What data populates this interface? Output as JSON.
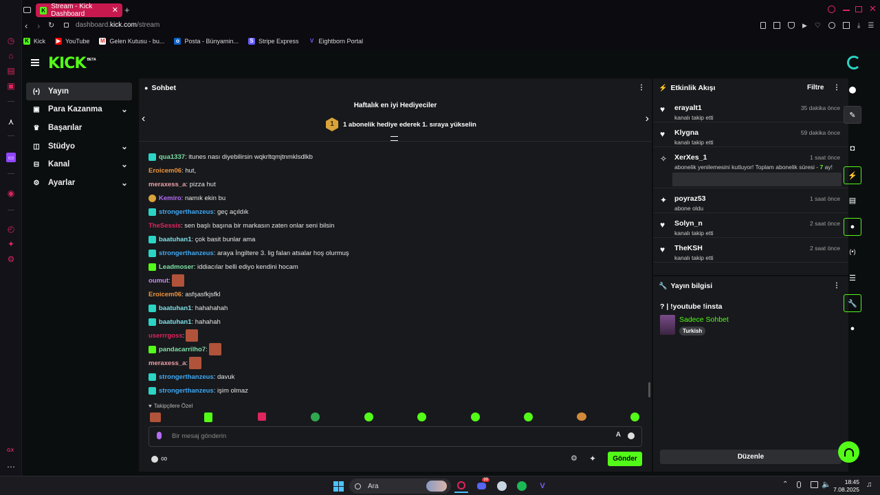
{
  "browser": {
    "tab_title": "Stream - Kick Dashboard",
    "url_prefix": "dashboard.",
    "url_domain": "kick.com",
    "url_path": "/stream",
    "bookmarks": [
      "Kick",
      "YouTube",
      "Gelen Kutusu - bu...",
      "Posta - Bünyamin...",
      "Stripe Express",
      "Eightborn Portal"
    ],
    "side_gx": "GX"
  },
  "kick": {
    "logo": "KICK",
    "logo_badge": "BETA",
    "nav": [
      {
        "label": "Yayın",
        "icon": "broadcast-icon"
      },
      {
        "label": "Para Kazanma",
        "icon": "money-icon"
      },
      {
        "label": "Başarılar",
        "icon": "trophy-icon"
      },
      {
        "label": "Stüdyo",
        "icon": "studio-icon"
      },
      {
        "label": "Kanal",
        "icon": "channel-icon"
      },
      {
        "label": "Ayarlar",
        "icon": "gear-icon"
      }
    ],
    "chat": {
      "title": "Sohbet",
      "gifters_title": "Haftalık en iyi Hediyeciler",
      "gifters_rank": "1",
      "gifters_text": "1 abonelik hediye ederek 1. sıraya yükselin",
      "messages": [
        {
          "user": "qua1337",
          "color": "#7ee0a8",
          "text": ": itunes nası diyebilirsin wqkrltqmjtnmklsdlkb",
          "badge": "sub"
        },
        {
          "user": "Eroicem06",
          "color": "#f0953d",
          "text": ": hut,",
          "badge": ""
        },
        {
          "user": "meraxess_a",
          "color": "#e8a0a8",
          "text": ": pizza hut",
          "badge": ""
        },
        {
          "user": "Kemiro",
          "color": "#b46cf5",
          "text": ": namık ekin bu",
          "badge": "gold"
        },
        {
          "user": "strongerthanzeus",
          "color": "#3fa9f5",
          "text": ": geç açıldık",
          "badge": "sub"
        },
        {
          "user": "TheSessis",
          "color": "#e0245e",
          "text": ": sen başlı başına bir markasın zaten onlar seni bilsin",
          "badge": ""
        },
        {
          "user": "baatuhan1",
          "color": "#7ee0e8",
          "text": ": çok basit bunlar ama",
          "badge": "sub"
        },
        {
          "user": "strongerthanzeus",
          "color": "#3fa9f5",
          "text": ": araya İngiltere 3. lig falan atsalar hoş olurmuş",
          "badge": "sub"
        },
        {
          "user": "Leadmoser",
          "color": "#7ee0a8",
          "text": ": iddiacılar belli ediyo kendini hocam",
          "badge": "green"
        },
        {
          "user": "oumut",
          "color": "#c58cf5",
          "text": ":",
          "badge": "",
          "emote": true
        },
        {
          "user": "Eroicem06",
          "color": "#f0953d",
          "text": ": asfşasfkjsfkl",
          "badge": ""
        },
        {
          "user": "baatuhan1",
          "color": "#7ee0e8",
          "text": ": hahahahah",
          "badge": "sub"
        },
        {
          "user": "baatuhan1",
          "color": "#7ee0e8",
          "text": ": hahahah",
          "badge": "sub"
        },
        {
          "user": "userrrgoss",
          "color": "#e0245e",
          "text": ":",
          "badge": "",
          "emote": true
        },
        {
          "user": "pandacarrilho7",
          "color": "#7ee0a8",
          "text": ":",
          "badge": "green",
          "emote": true
        },
        {
          "user": "meraxess_a",
          "color": "#e8a0a8",
          "text": ":",
          "badge": "",
          "emote": true
        },
        {
          "user": "strongerthanzeus",
          "color": "#3fa9f5",
          "text": ": davuk",
          "badge": "sub"
        },
        {
          "user": "strongerthanzeus",
          "color": "#3fa9f5",
          "text": ": işim olmaz",
          "badge": "sub"
        }
      ],
      "followers_only": "Takipçilere Özel",
      "input_placeholder": "Bir mesaj gönderin",
      "send_label": "Gönder",
      "infinity": "∞"
    },
    "activity": {
      "title": "Etkinlik Akışı",
      "filter_label": "Filtre",
      "events": [
        {
          "name": "erayalt1",
          "sub": "kanalı takip etti",
          "time": "35 dakika önce",
          "icon": "heart-icon"
        },
        {
          "name": "Klygna",
          "sub": "kanalı takip etti",
          "time": "59 dakika önce",
          "icon": "heart-icon"
        },
        {
          "name": "XerXes_1",
          "sub": "abonelik yenilemesini kutluyor! Toplam abonelik süresi - ",
          "sub_hl": "7",
          "sub_end": " ay!",
          "time": "1 saat önce",
          "icon": "resub-icon"
        },
        {
          "name": "poyraz53",
          "sub": "abone oldu",
          "time": "1 saat önce",
          "icon": "sparkle-icon"
        },
        {
          "name": "Solyn_n",
          "sub": "kanalı takip etti",
          "time": "2 saat önce",
          "icon": "heart-icon"
        },
        {
          "name": "TheKSH",
          "sub": "kanalı takip etti",
          "time": "2 saat önce",
          "icon": "heart-icon"
        }
      ]
    },
    "stream_info": {
      "title": "Yayın bilgisi",
      "stream_title": "? | !youtube !insta",
      "category": "Sadece Sohbet",
      "language": "Turkish",
      "edit_label": "Düzenle"
    }
  },
  "taskbar": {
    "search": "Ara",
    "time": "18:45",
    "date": "7.08.2025",
    "discord_badge": "99"
  }
}
